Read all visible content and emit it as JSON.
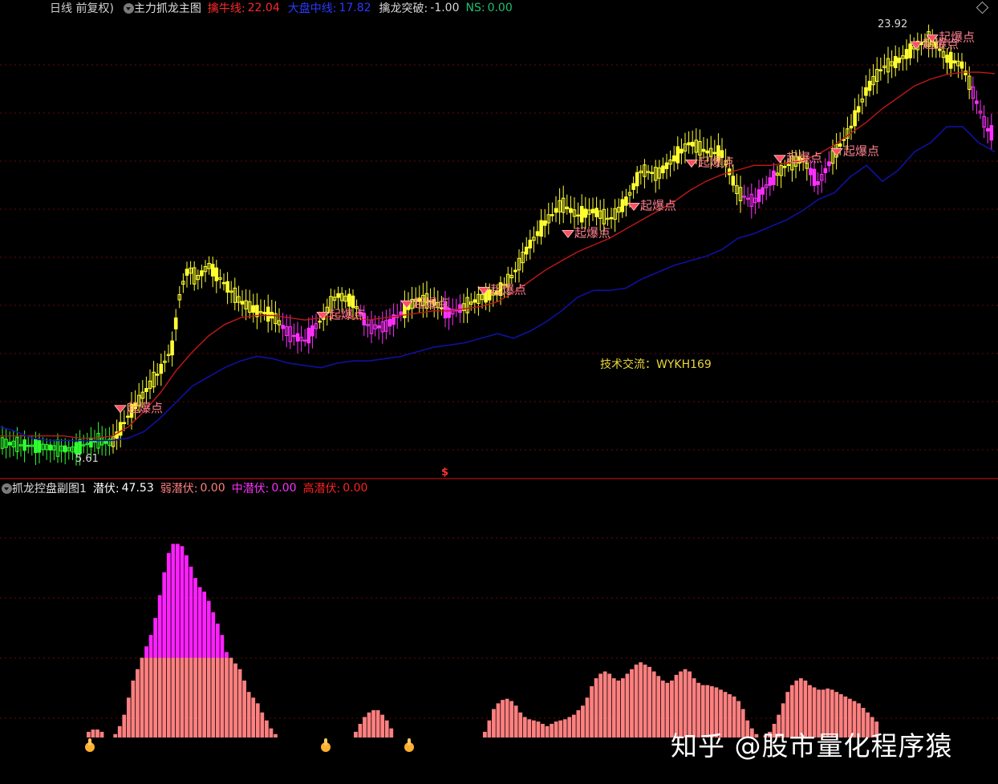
{
  "main_header": {
    "period_label": "日线 前复权)",
    "indicator_name": "主力抓龙主图",
    "items": [
      {
        "label": "擒牛线:",
        "value": "22.04",
        "color": "#ff2a2a"
      },
      {
        "label": "大盘中线:",
        "value": "17.82",
        "color": "#2a3aff"
      },
      {
        "label": "擒龙突破:",
        "value": "-1.00",
        "color": "#d8d8d8"
      },
      {
        "label": "NS:",
        "value": "0.00",
        "color": "#20c070"
      }
    ]
  },
  "sub_header": {
    "indicator_name": "抓龙控盘副图1",
    "items": [
      {
        "label": "潜伏:",
        "value": "47.53",
        "color": "#ffffff"
      },
      {
        "label": "弱潜伏:",
        "value": "0.00",
        "color": "#ff7f7f"
      },
      {
        "label": "中潜伏:",
        "value": "0.00",
        "color": "#ff30ff"
      },
      {
        "label": "高潜伏:",
        "value": "0.00",
        "color": "#ff2020"
      }
    ]
  },
  "annotations": {
    "max_price_label": "23.92",
    "min_price_label": "5.61",
    "signal_label": "起爆点",
    "contact_text": "技术交流：WYKH169",
    "dollar_mark": "$"
  },
  "watermark": "知乎 @股市量化程序猿",
  "colors": {
    "background": "#000000",
    "up_candle": "#ffff30",
    "down_candle_magenta": "#ff30ff",
    "green_candle": "#30ff30",
    "red_line": "#c01818",
    "blue_line": "#1010a0",
    "grid": "#6a0a0a",
    "hist_base": "#ff8080",
    "hist_top": "#ff20ff"
  },
  "chart_data": [
    {
      "type": "line",
      "title": "主力抓龙主图",
      "series": [
        {
          "name": "擒牛线",
          "last_value": 22.04,
          "x": [
            0,
            20,
            40,
            60,
            80,
            100,
            120,
            140,
            160,
            180,
            200,
            220,
            240,
            260,
            280,
            300,
            320,
            340,
            360,
            380,
            400,
            420,
            440,
            460,
            480,
            500,
            520,
            540,
            560,
            580,
            600,
            620,
            640,
            660,
            680,
            700,
            720,
            740,
            760,
            780,
            800,
            820,
            840,
            860,
            880,
            900,
            920,
            940,
            960,
            980,
            1000,
            1020,
            1040,
            1060,
            1080,
            1100,
            1120,
            1140,
            1160,
            1180,
            1200,
            1220,
            1240
          ],
          "y": [
            6.1,
            6.1,
            6.1,
            6.1,
            6.1,
            6.0,
            6.0,
            6.1,
            6.5,
            7.2,
            8.0,
            9.0,
            9.8,
            10.5,
            11.0,
            11.3,
            11.4,
            11.4,
            11.3,
            11.2,
            11.3,
            11.4,
            11.3,
            11.2,
            11.3,
            11.4,
            11.5,
            11.6,
            11.6,
            11.7,
            11.8,
            12.0,
            12.4,
            12.9,
            13.4,
            13.8,
            14.2,
            14.5,
            14.8,
            15.2,
            15.6,
            16.0,
            16.4,
            16.9,
            17.3,
            17.6,
            17.8,
            18.0,
            18.0,
            18.1,
            18.2,
            18.5,
            18.9,
            19.4,
            19.9,
            20.5,
            21.0,
            21.5,
            21.8,
            22.0,
            22.1,
            22.1,
            22.04
          ]
        },
        {
          "name": "大盘中线",
          "last_value": 17.82,
          "x": [
            0,
            20,
            40,
            60,
            80,
            100,
            120,
            140,
            160,
            180,
            200,
            220,
            240,
            260,
            280,
            300,
            320,
            340,
            360,
            380,
            400,
            420,
            440,
            460,
            480,
            500,
            520,
            540,
            560,
            580,
            600,
            620,
            640,
            660,
            680,
            700,
            720,
            740,
            760,
            780,
            800,
            820,
            840,
            860,
            880,
            900,
            920,
            940,
            960,
            980,
            1000,
            1020,
            1040,
            1060,
            1080,
            1100,
            1120,
            1140,
            1160,
            1180,
            1200,
            1220,
            1240
          ],
          "y": [
            6.5,
            6.3,
            6.0,
            5.9,
            5.9,
            5.9,
            5.9,
            5.9,
            6.0,
            6.3,
            6.9,
            7.6,
            8.3,
            8.7,
            9.1,
            9.4,
            9.6,
            9.5,
            9.3,
            9.2,
            9.1,
            9.3,
            9.4,
            9.4,
            9.5,
            9.6,
            9.8,
            10.0,
            10.1,
            10.2,
            10.4,
            10.6,
            10.4,
            10.7,
            11.1,
            11.6,
            12.2,
            12.5,
            12.5,
            12.6,
            13.0,
            13.3,
            13.6,
            13.8,
            14.0,
            14.3,
            14.8,
            15.0,
            15.3,
            15.6,
            16.0,
            16.5,
            16.8,
            17.5,
            18.0,
            17.3,
            17.8,
            18.6,
            19.0,
            19.7,
            19.7,
            19.0,
            18.6
          ]
        }
      ],
      "candles": {
        "ylim": [
          5.0,
          24.5
        ],
        "max_label": 23.92,
        "min_label": 5.61
      }
    },
    {
      "type": "bar",
      "title": "抓龙控盘副图1",
      "series": [
        {
          "name": "潜伏",
          "last_value": 47.53,
          "values": [
            5,
            7,
            7,
            5,
            0,
            0,
            3,
            10,
            20,
            35,
            50,
            60,
            70,
            70,
            70,
            70,
            70,
            70,
            70,
            70,
            70,
            70,
            70,
            70,
            70,
            70,
            70,
            70,
            70,
            70,
            70,
            70,
            70,
            65,
            60,
            50,
            40,
            35,
            30,
            22,
            15,
            8,
            3,
            0,
            0,
            0,
            0,
            0,
            0,
            0,
            0,
            0,
            0,
            0,
            0,
            0,
            0,
            0,
            0,
            0,
            5,
            12,
            18,
            22,
            24,
            24,
            20,
            15,
            8,
            0,
            0,
            0,
            0,
            0,
            0,
            0,
            0,
            0,
            0,
            0,
            0,
            0,
            0,
            0,
            0,
            0,
            0,
            0,
            0,
            5,
            15,
            25,
            30,
            33,
            34,
            32,
            28,
            22,
            18,
            16,
            15,
            14,
            12,
            10,
            12,
            14,
            15,
            16,
            18,
            20,
            24,
            28,
            35,
            45,
            52,
            56,
            58,
            56,
            52,
            50,
            52,
            56,
            60,
            64,
            66,
            64,
            62,
            58,
            54,
            50,
            48,
            50,
            55,
            58,
            60,
            58,
            52,
            48,
            46,
            46,
            45,
            44,
            42,
            40,
            38,
            36,
            32,
            25,
            15,
            8,
            3,
            0,
            2,
            5,
            12,
            20,
            30,
            40,
            46,
            50,
            52,
            50,
            46,
            44,
            42,
            42,
            43,
            42,
            40,
            38,
            36,
            34,
            32,
            30,
            26,
            22,
            18,
            14
          ]
        },
        {
          "name": "中潜伏",
          "values": [
            0,
            0,
            0,
            0,
            0,
            0,
            0,
            0,
            0,
            0,
            0,
            0,
            0,
            10,
            20,
            35,
            55,
            75,
            92,
            100,
            100,
            98,
            90,
            80,
            70,
            62,
            58,
            50,
            40,
            30,
            20,
            5,
            0,
            0,
            0,
            0,
            0,
            0,
            0,
            0,
            0,
            0,
            0,
            0,
            0,
            0,
            0,
            0,
            0,
            0,
            0,
            0,
            0,
            0,
            0,
            0,
            0,
            0,
            0,
            0,
            0,
            0,
            0,
            0,
            0,
            0,
            0,
            0,
            0,
            0,
            0,
            0,
            0,
            0,
            0,
            0,
            0,
            0,
            0,
            0,
            0,
            0,
            0,
            0,
            0,
            0,
            0,
            0,
            0,
            0,
            0,
            0,
            0,
            0,
            0,
            0,
            0,
            0,
            0,
            0,
            0,
            0,
            0,
            0,
            0,
            0,
            0,
            0,
            0,
            0,
            0,
            0,
            0,
            0,
            0,
            0,
            0,
            0,
            0,
            0,
            0,
            0,
            0,
            0,
            0,
            0,
            0,
            0,
            0,
            0,
            0,
            0,
            0,
            0,
            0,
            0,
            0,
            0,
            0,
            0,
            0,
            0,
            0,
            0,
            0,
            0,
            0,
            0,
            0,
            0,
            0,
            0,
            0,
            0,
            0,
            0,
            0,
            0,
            0,
            0,
            0,
            0,
            0,
            0,
            0,
            0,
            0,
            0,
            0,
            0,
            0,
            0,
            0,
            0,
            0,
            0,
            0
          ]
        }
      ],
      "ylim": [
        0,
        190
      ]
    }
  ]
}
